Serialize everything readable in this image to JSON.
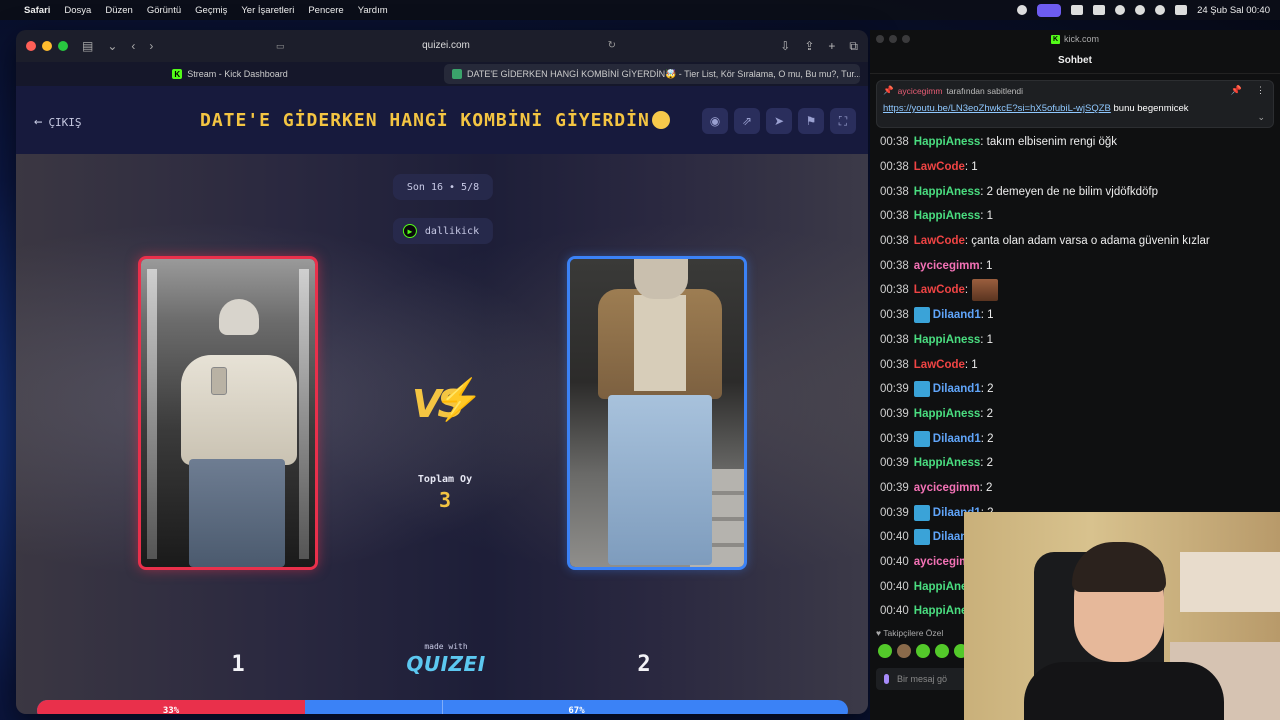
{
  "menubar": {
    "app": "Safari",
    "items": [
      "Dosya",
      "Düzen",
      "Görüntü",
      "Geçmiş",
      "Yer İşaretleri",
      "Pencere",
      "Yardım"
    ],
    "datetime": "24 Şub Sal  00:40"
  },
  "browser": {
    "url": "quizei.com",
    "tabs": [
      {
        "label": "Stream - Kick Dashboard",
        "active": false
      },
      {
        "label": "DATE'E GİDERKEN HANGİ KOMBİNİ GİYERDİN🤯 - Tier List, Kör Sıralama, O mu, Bu mu?, Tur...",
        "active": true
      }
    ]
  },
  "quiz": {
    "exit_label": "ÇIKIŞ",
    "title": "DATE'E GİDERKEN HANGİ KOMBİNİ GİYERDİN",
    "round": "Son 16 • 5/8",
    "username": "dallikick",
    "total_votes_label": "Toplam Oy",
    "total_votes": "3",
    "made_with": "made with",
    "brand": "QUIZEI",
    "option_left_number": "1",
    "option_right_number": "2",
    "left_percent_value": 33,
    "left_percent": "33%",
    "right_percent": "67%",
    "colors": {
      "accent": "#f4c542",
      "left": "#e9304b",
      "right": "#3b82f6",
      "brand": "#5cc8f0"
    }
  },
  "chat": {
    "window_title": "kick.com",
    "header": "Sohbet",
    "pinned_by_user": "aycicegimm",
    "pinned_by_text": "tarafından sabitlendi",
    "pinned_link": "https://youtu.be/LN3eoZhwkcE?si=hX5ofubiL-wjSQZB",
    "pinned_suffix": "bunu begenmicek",
    "messages": [
      {
        "time": "00:38",
        "user": "HappiAness",
        "color": "#4ade80",
        "badge": false,
        "text": ": takım elbisenim rengi öğk"
      },
      {
        "time": "00:38",
        "user": "LawCode",
        "color": "#ef4444",
        "badge": false,
        "text": ": 1"
      },
      {
        "time": "00:38",
        "user": "HappiAness",
        "color": "#4ade80",
        "badge": false,
        "text": ": 2 demeyen de ne bilim vjdöfkdöfp"
      },
      {
        "time": "00:38",
        "user": "HappiAness",
        "color": "#4ade80",
        "badge": false,
        "text": ": 1"
      },
      {
        "time": "00:38",
        "user": "LawCode",
        "color": "#ef4444",
        "badge": false,
        "text": ": çanta olan adam varsa o adama güvenin kızlar"
      },
      {
        "time": "00:38",
        "user": "aycicegimm",
        "color": "#f472b6",
        "badge": false,
        "text": ": 1"
      },
      {
        "time": "00:38",
        "user": "LawCode",
        "color": "#ef4444",
        "badge": false,
        "text": ":",
        "emote": true
      },
      {
        "time": "00:38",
        "user": "Dilaand1",
        "color": "#60a5fa",
        "badge": true,
        "text": ": 1"
      },
      {
        "time": "00:38",
        "user": "HappiAness",
        "color": "#4ade80",
        "badge": false,
        "text": ": 1"
      },
      {
        "time": "00:38",
        "user": "LawCode",
        "color": "#ef4444",
        "badge": false,
        "text": ": 1"
      },
      {
        "time": "00:39",
        "user": "Dilaand1",
        "color": "#60a5fa",
        "badge": true,
        "text": ": 2"
      },
      {
        "time": "00:39",
        "user": "HappiAness",
        "color": "#4ade80",
        "badge": false,
        "text": ": 2"
      },
      {
        "time": "00:39",
        "user": "Dilaand1",
        "color": "#60a5fa",
        "badge": true,
        "text": ": 2"
      },
      {
        "time": "00:39",
        "user": "HappiAness",
        "color": "#4ade80",
        "badge": false,
        "text": ": 2"
      },
      {
        "time": "00:39",
        "user": "aycicegimm",
        "color": "#f472b6",
        "badge": false,
        "text": ": 2"
      },
      {
        "time": "00:39",
        "user": "Dilaand1",
        "color": "#60a5fa",
        "badge": true,
        "text": ": 2"
      },
      {
        "time": "00:40",
        "user": "Dilaand1",
        "color": "#60a5fa",
        "badge": true,
        "text": ""
      },
      {
        "time": "00:40",
        "user": "aycicegimm",
        "color": "#f472b6",
        "badge": false,
        "text": ""
      },
      {
        "time": "00:40",
        "user": "HappiAness",
        "color": "#4ade80",
        "badge": false,
        "text": ""
      },
      {
        "time": "00:40",
        "user": "HappiAness",
        "color": "#4ade80",
        "badge": false,
        "text": ""
      }
    ],
    "followers_label": "Takipçilere Özel",
    "input_placeholder": "Bir mesaj gö"
  }
}
